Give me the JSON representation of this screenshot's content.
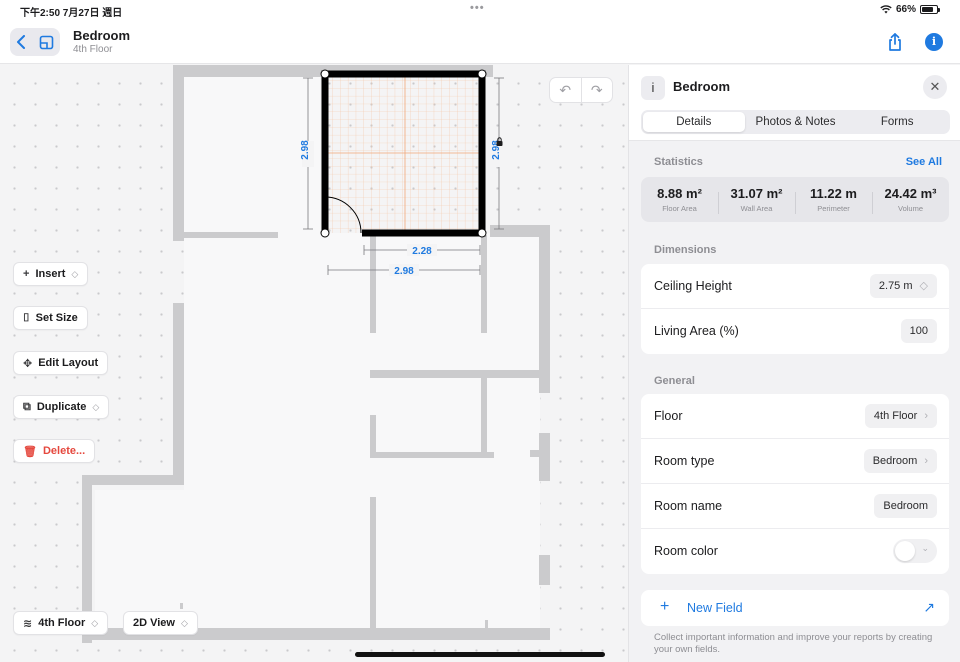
{
  "status_bar": {
    "time": "下午2:50  7月27日 週日",
    "dots": "•••",
    "battery": "66%",
    "battery_level": 0.66
  },
  "header": {
    "back_icon": "chevron-left-icon",
    "plan_icon": "floorplan-icon",
    "title": "Bedroom",
    "subtitle": "4th Floor",
    "share_icon": "share-icon",
    "info_icon": "info-icon",
    "info_glyph": "i"
  },
  "canvas": {
    "undo_icon": "↶",
    "redo_icon": "↷",
    "dimensions": {
      "left": "2.98",
      "right": "2.98",
      "bottom_inner": "2.28",
      "bottom_outer": "2.98"
    },
    "tools": [
      {
        "icon": "+",
        "label": "Insert",
        "chevron": "◇"
      },
      {
        "icon": "⌷",
        "label": "Set Size"
      },
      {
        "icon": "✥",
        "label": "Edit Layout"
      },
      {
        "icon": "⧉",
        "label": "Duplicate",
        "chevron": "◇"
      },
      {
        "icon": "🗑",
        "label": "Delete..."
      }
    ],
    "floor_button": {
      "icon": "≋",
      "label": "4th Floor",
      "chevron": "◇"
    },
    "view_button": {
      "label": "2D View",
      "chevron": "◇"
    }
  },
  "panel": {
    "info_glyph": "i",
    "title": "Bedroom",
    "close_glyph": "✕",
    "tabs": [
      "Details",
      "Photos & Notes",
      "Forms"
    ],
    "active_tab": 0,
    "statistics": {
      "label": "Statistics",
      "see_all": "See All",
      "items": [
        {
          "value": "8.88 m²",
          "label": "Floor Area"
        },
        {
          "value": "31.07 m²",
          "label": "Wall Area"
        },
        {
          "value": "11.22 m",
          "label": "Perimeter"
        },
        {
          "value": "24.42 m³",
          "label": "Volume"
        }
      ]
    },
    "dimensions": {
      "label": "Dimensions",
      "ceiling_label": "Ceiling Height",
      "ceiling_value": "2.75 m",
      "stepper": "◇",
      "living_label": "Living Area (%)",
      "living_value": "100"
    },
    "general": {
      "label": "General",
      "floor_label": "Floor",
      "floor_value": "4th Floor",
      "type_label": "Room type",
      "type_value": "Bedroom",
      "name_label": "Room name",
      "name_value": "Bedroom",
      "color_label": "Room color",
      "chevron": "›",
      "toggle_chevron": "⌄"
    },
    "new_field": {
      "plus": "+",
      "label": "New Field",
      "arrow": "↗"
    },
    "hint": "Collect important information and improve your reports by creating your own fields."
  },
  "colors": {
    "accent": "#1f7ae0",
    "danger": "#e5483e",
    "wall": "#cbcbcd",
    "selected_wall": "#000000",
    "grid_line": "#f6c7a6"
  }
}
